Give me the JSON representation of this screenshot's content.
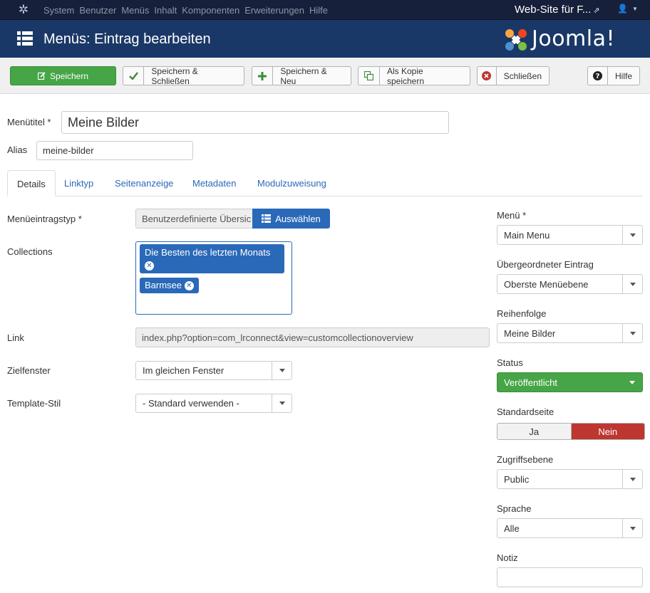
{
  "topbar": {
    "menu": [
      "System",
      "Benutzer",
      "Menüs",
      "Inhalt",
      "Komponenten",
      "Erweiterungen",
      "Hilfe"
    ],
    "site_label": "Web-Site für F...",
    "ext_glyph": "⇗",
    "user_glyph": "👤",
    "caret_glyph": "▼"
  },
  "header": {
    "title": "Menüs: Eintrag bearbeiten",
    "brand": "Joomla!"
  },
  "toolbar": {
    "save": "Speichern",
    "save_close": "Speichern & Schließen",
    "save_new": "Speichern & Neu",
    "save_copy": "Als Kopie speichern",
    "close": "Schließen",
    "help": "Hilfe"
  },
  "form": {
    "title_label": "Menütitel *",
    "title_value": "Meine Bilder",
    "alias_label": "Alias",
    "alias_value": "meine-bilder"
  },
  "tabs": [
    "Details",
    "Linktyp",
    "Seitenanzeige",
    "Metadaten",
    "Modulzuweisung"
  ],
  "details": {
    "type_label": "Menüeintragstyp *",
    "type_value": "Benutzerdefinierte Übersic",
    "select_btn": "Auswählen",
    "collections_label": "Collections",
    "collections": [
      "Die Besten des letzten Monats",
      "Barmsee"
    ],
    "link_label": "Link",
    "link_value": "index.php?option=com_lrconnect&view=customcollectionoverview",
    "target_label": "Zielfenster",
    "target_value": "Im gleichen Fenster",
    "template_label": "Template-Stil",
    "template_value": "- Standard verwenden -"
  },
  "sidebar": {
    "menu_label": "Menü *",
    "menu_value": "Main Menu",
    "parent_label": "Übergeordneter Eintrag",
    "parent_value": "Oberste Menüebene",
    "order_label": "Reihenfolge",
    "order_value": "Meine Bilder",
    "status_label": "Status",
    "status_value": "Veröffentlicht",
    "home_label": "Standardseite",
    "home_yes": "Ja",
    "home_no": "Nein",
    "access_label": "Zugriffsebene",
    "access_value": "Public",
    "language_label": "Sprache",
    "language_value": "Alle",
    "note_label": "Notiz",
    "note_value": ""
  },
  "colors": {
    "navbar": "#17203a",
    "header": "#1a3867",
    "save_green": "#46a546",
    "primary_blue": "#2a69b8",
    "danger_red": "#bd362f"
  }
}
